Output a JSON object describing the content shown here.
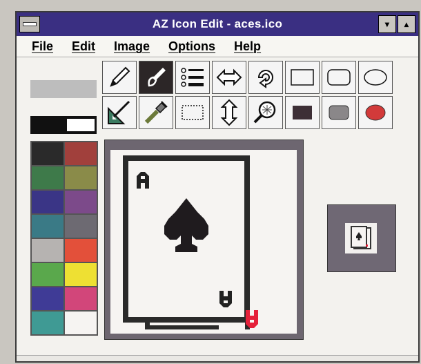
{
  "window": {
    "title": "AZ Icon Edit - aces.ico",
    "minimize_glyph": "▾",
    "maximize_glyph": "▴"
  },
  "menu": {
    "items": [
      "File",
      "Edit",
      "Image",
      "Options",
      "Help"
    ]
  },
  "toolbar": {
    "undo_label": "",
    "tools": [
      {
        "name": "pencil-icon"
      },
      {
        "name": "brush-icon"
      },
      {
        "name": "bullet-list-icon"
      },
      {
        "name": "flip-horizontal-icon"
      },
      {
        "name": "rotate-icon"
      },
      {
        "name": "rectangle-outline-icon"
      },
      {
        "name": "rounded-rectangle-outline-icon"
      },
      {
        "name": "ellipse-outline-icon"
      },
      {
        "name": "line-drawing-icon"
      },
      {
        "name": "eyedropper-icon"
      },
      {
        "name": "selection-marquee-icon"
      },
      {
        "name": "flip-vertical-icon"
      },
      {
        "name": "magnify-icon"
      },
      {
        "name": "filled-rectangle-icon"
      },
      {
        "name": "filled-rounded-rectangle-icon"
      },
      {
        "name": "filled-ellipse-icon"
      }
    ]
  },
  "colors": {
    "titlebar": "#3a2f82",
    "current_foreground": "#111111",
    "current_background": "#ffffff",
    "palette": [
      "#2a2a2a",
      "#a1403c",
      "#3e7a4a",
      "#8a8b49",
      "#3a3586",
      "#7c4a8a",
      "#3a7a86",
      "#6d6a72",
      "#b6b3b1",
      "#e3503a",
      "#5aa84c",
      "#eee033",
      "#3f3b96",
      "#d2467a",
      "#3f9a94",
      "#f6f4f2"
    ]
  },
  "image": {
    "filename": "aces.ico",
    "rank_glyph": "A",
    "suit_glyph": "♠"
  }
}
